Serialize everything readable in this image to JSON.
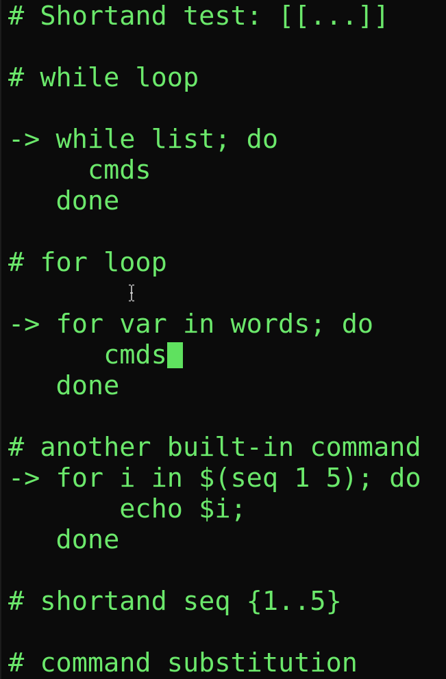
{
  "terminal": {
    "text_color": "#6be86b",
    "background_color": "#0b0b0b",
    "cursor_color": "#5fe15f",
    "lines": [
      "# Shortand test: [[...]]",
      "",
      "# while loop",
      "",
      "-> while list; do",
      "     cmds",
      "   done",
      "",
      "# for loop",
      "",
      "",
      "-> for var in words; do",
      "      cmds",
      "   done",
      "",
      "# another built-in command",
      "-> for i in $(seq 1 5); do",
      "       echo $i;",
      "   done",
      "",
      "# shortand seq {1..5}",
      "",
      "# command substitution"
    ],
    "cursor_line": 12,
    "mouse_pointer_icon": "i-beam-cursor-icon"
  }
}
